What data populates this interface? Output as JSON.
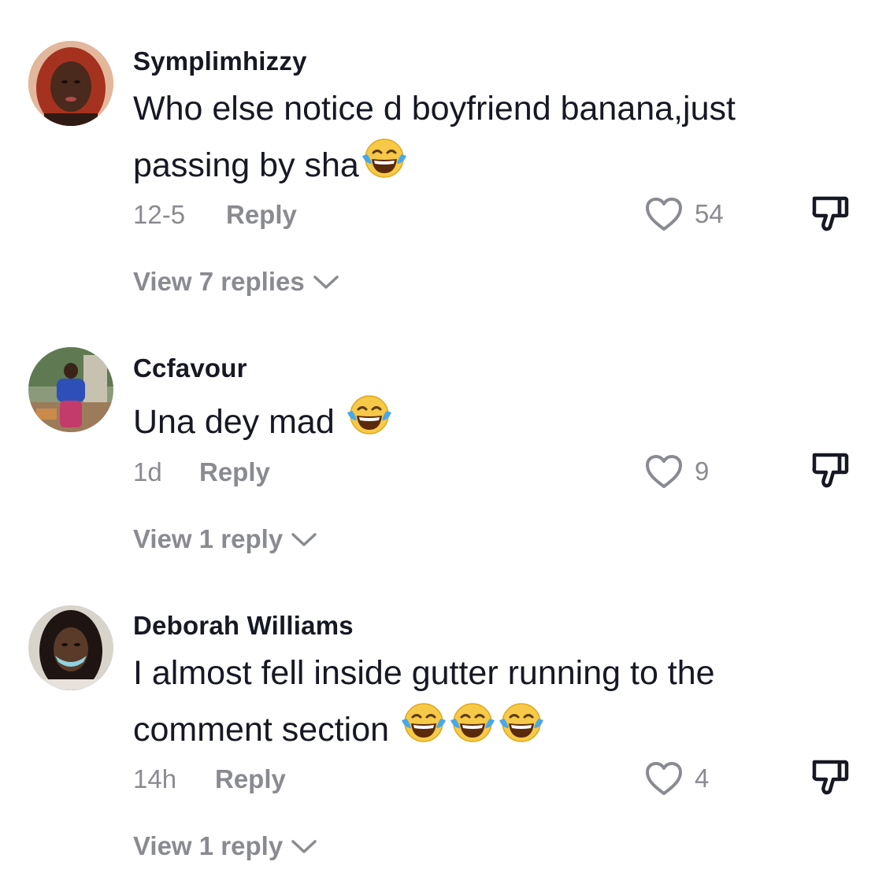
{
  "comments": [
    {
      "username": "Symplimhizzy",
      "text": "Who else notice d boyfriend banana,just passing by sha",
      "emoji_count": 1,
      "emoji_icon": "face-with-tears-of-joy-icon",
      "time": "12-5",
      "reply_label": "Reply",
      "likes": "54",
      "view_replies": "View 7 replies"
    },
    {
      "username": "Ccfavour",
      "text": "Una dey mad ",
      "emoji_count": 1,
      "emoji_icon": "face-with-tears-of-joy-icon",
      "time": "1d",
      "reply_label": "Reply",
      "likes": "9",
      "view_replies": "View 1 reply"
    },
    {
      "username": "Deborah Williams",
      "text": "I almost fell inside gutter running to the comment section ",
      "emoji_count": 3,
      "emoji_icon": "face-with-tears-of-joy-icon",
      "time": "14h",
      "reply_label": "Reply",
      "likes": "4",
      "view_replies": "View 1 reply"
    }
  ],
  "colors": {
    "primary_text": "#161823",
    "secondary_text": "#8a8b91",
    "background": "#ffffff"
  },
  "icons": {
    "like": "heart-outline-icon",
    "dislike": "thumbs-down-icon",
    "expand": "chevron-down-icon"
  }
}
